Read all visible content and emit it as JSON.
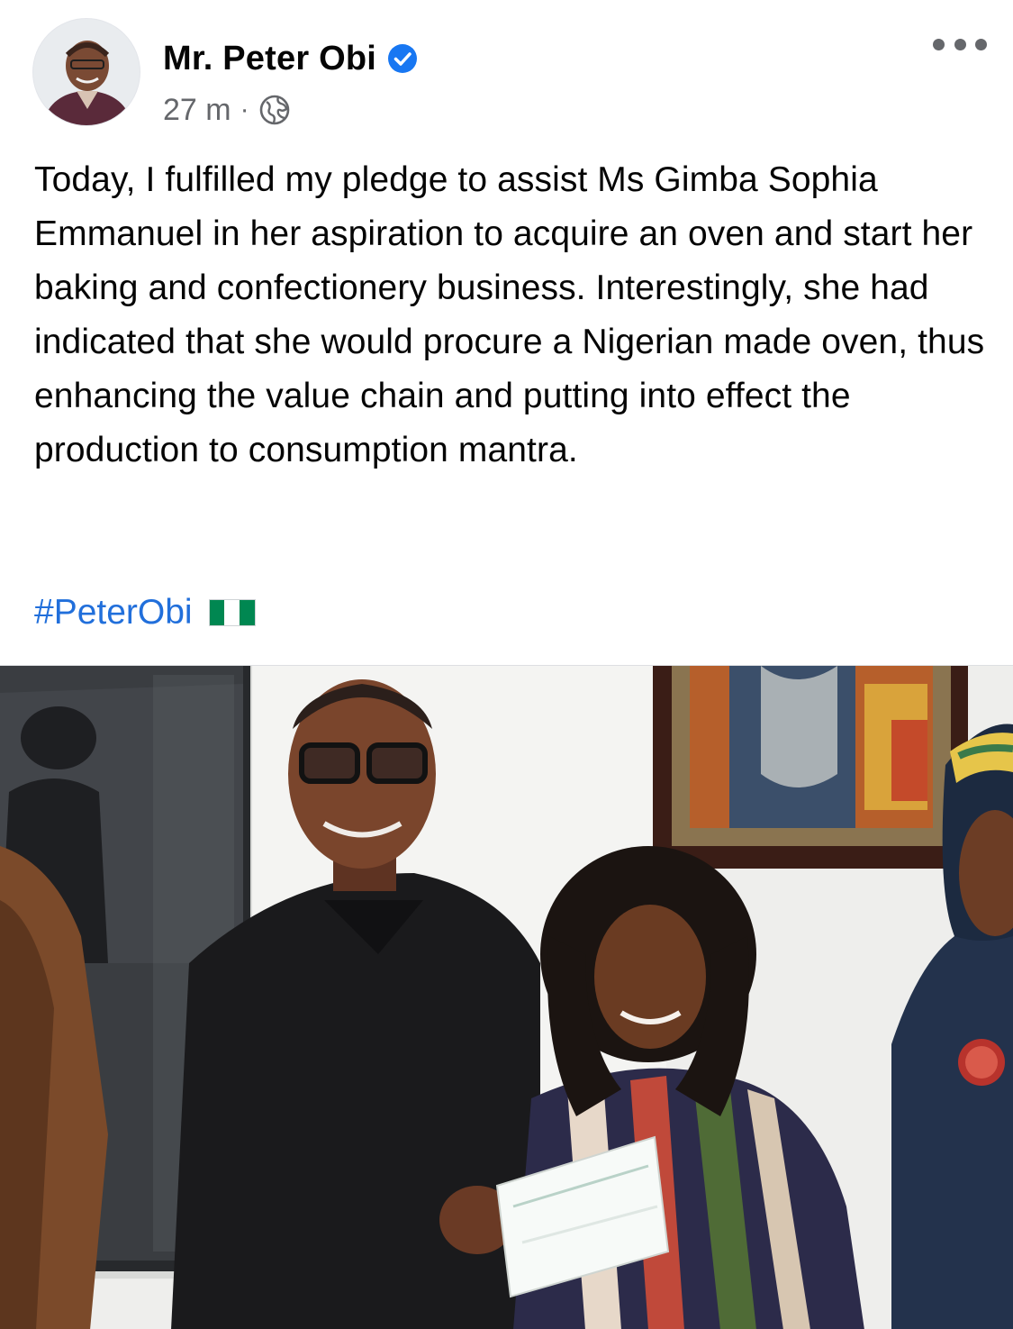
{
  "post": {
    "author": "Mr. Peter Obi",
    "time": "27 m",
    "separator": "·",
    "text": "Today, I fulfilled my pledge to assist Ms Gimba Sophia Emmanuel in her aspiration to acquire an oven and start her baking and confectionery business. Interestingly, she had indicated that she would procure a Nigerian made oven, thus enhancing the value chain and putting into effect the production to consumption mantra.",
    "hashtag": "#PeterObi",
    "flag_emoji": "nigeria-flag"
  },
  "colors": {
    "text": "#050505",
    "meta": "#65676b",
    "link": "#216fdb",
    "verified": "#1877f2",
    "flag_green": "#008751",
    "flag_white": "#ffffff"
  },
  "icons": {
    "verified": "verified-badge-icon",
    "privacy": "globe-icon",
    "menu": "more-horizontal-icon"
  }
}
